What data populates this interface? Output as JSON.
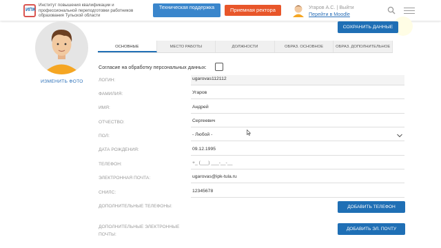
{
  "header": {
    "logo_text": "ИПК",
    "org_name": "Институт повышения квалификации и профессиональной переподготовки работников образования Тульской области",
    "support_button": "Техническая поддержка",
    "rector_button": "Приемная ректора",
    "user_name": "Угаров А.С. | Выйти",
    "moodle_link": "Перейти в Moodle"
  },
  "profile": {
    "change_photo": "ИЗМЕНИТЬ ФОТО",
    "save_button": "СОХРАНИТЬ ДАННЫЕ"
  },
  "tabs": [
    {
      "label": "ОСНОВНЫЕ",
      "active": true
    },
    {
      "label": "МЕСТО РАБОТЫ",
      "active": false
    },
    {
      "label": "ДОЛЖНОСТИ",
      "active": false
    },
    {
      "label": "ОБРАЗ. ОСНОВНОЕ",
      "active": false
    },
    {
      "label": "ОБРАЗ. ДОПОЛНИТЕЛЬНОЕ",
      "active": false
    }
  ],
  "form": {
    "consent_label": "Согласие на обработку персональных данных:",
    "login_label": "ЛОГИН:",
    "login_value": "ugarovas112112",
    "surname_label": "ФАМИЛИЯ:",
    "surname_value": "Угаров",
    "name_label": "ИМЯ:",
    "name_value": "Андрей",
    "patronymic_label": "ОТЧЕСТВО:",
    "patronymic_value": "Сергеевич",
    "gender_label": "ПОЛ:",
    "gender_value": "- Любой -",
    "birth_label": "ДАТА РОЖДЕНИЯ:",
    "birth_value": "09.12.1995",
    "phone_label": "ТЕЛЕФОН:",
    "phone_placeholder": "+_ (___) ___-__-__",
    "email_label": "ЭЛЕКТРОННАЯ ПОЧТА:",
    "email_value": "ugarovas@ipk-tula.ru",
    "snils_label": "СНИЛС:",
    "snils_value": "12345678",
    "extra_phones_label": "ДОПОЛНИТЕЛЬНЫЕ ТЕЛЕФОНЫ:",
    "add_phone_button": "ДОБАВИТЬ ТЕЛЕФОН",
    "extra_emails_label_1": "ДОПОЛНИТЕЛЬНЫЕ ЭЛЕКТРОННЫЕ",
    "extra_emails_label_2": "ПОЧТЫ:",
    "add_email_button": "ДОБАВИТЬ ЭЛ. ПОЧТУ"
  },
  "colors": {
    "primary": "#1f6fb5",
    "support": "#3a86cc",
    "rector": "#e8562a",
    "link": "#2a6fb8"
  }
}
